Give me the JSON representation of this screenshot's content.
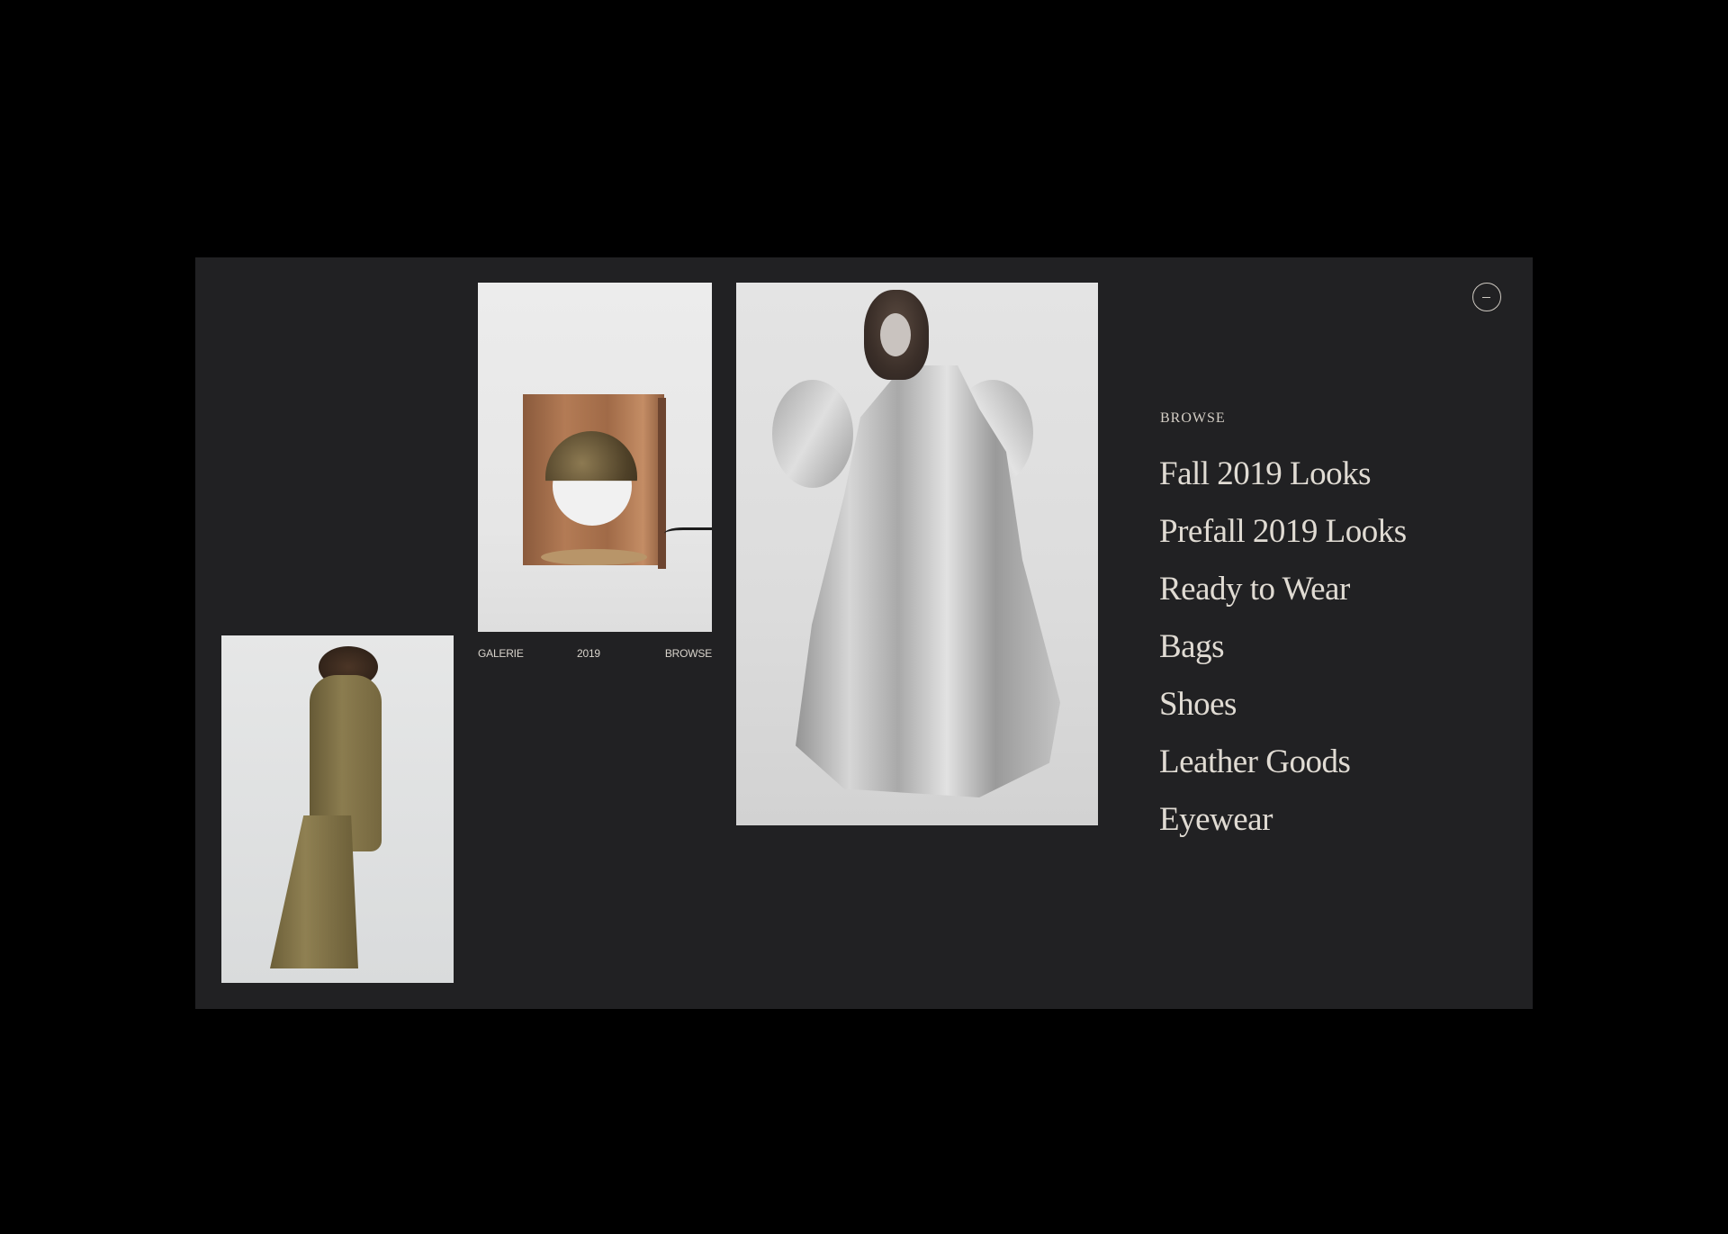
{
  "captions": {
    "left": "GALERIE",
    "middle": "2019",
    "right": "BROWSE"
  },
  "close_button": {
    "icon": "minus-circle-icon"
  },
  "browse": {
    "heading": "BROWSE",
    "items": [
      "Fall 2019 Looks",
      "Prefall 2019 Looks",
      "Ready to Wear",
      "Bags",
      "Shoes",
      "Leather Goods",
      "Eyewear"
    ]
  },
  "colors": {
    "page_background": "#000000",
    "panel_background": "#212123",
    "text": "#e0dbd3"
  }
}
